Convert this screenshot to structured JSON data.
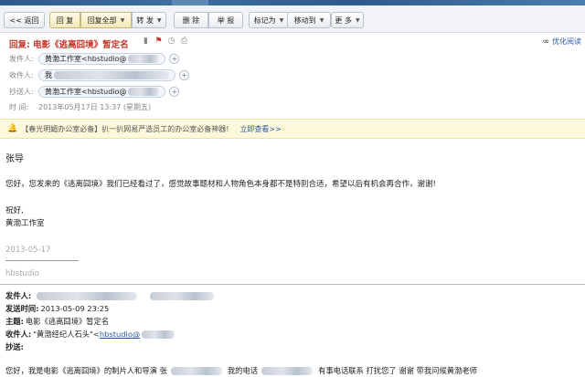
{
  "toolbar": {
    "back": "<< 返回",
    "reply": "回 复",
    "reply_all": "回复全部",
    "forward": "转 发",
    "delete": "删 除",
    "report": "举 报",
    "mark_as": "标记为",
    "move_to": "移动到",
    "more": "更 多"
  },
  "header": {
    "subject": "回复: 电影《逃离囧境》暂定名",
    "optimized_read": "优化阅读",
    "sender_label": "发件人:",
    "sender": "黄渤工作室<hbstudio@",
    "recipient_label": "收件人:",
    "recipient": "我",
    "cc_label": "抄送人:",
    "cc": "黄渤工作室<hbstudio@",
    "time_label": "时 间:",
    "time": "2013年05月17日 13:37 (星期五)"
  },
  "promo": {
    "text": "【春光明媚办公室必备】扒一扒网易严选员工的办公室必备神器!",
    "link": "立即查看>>"
  },
  "body": {
    "greeting": "张导",
    "paragraph": "您好，您发来的《逃离囧境》我们已经看过了，感觉故事题材和人物角色本身都不是特别合适，希望以后有机会再合作，谢谢!",
    "closing": "祝好,",
    "signature": "黄渤工作室",
    "date": "2013-05-17",
    "sig_name": "hbstudio",
    "fwd_from_label": "发件人:",
    "fwd_sent_label": "发送时间:",
    "fwd_sent": "2013-05-09 23:25",
    "fwd_subject_label": "主题:",
    "fwd_subject": "电影《逃离囧境》暂定名",
    "fwd_to_label": "收件人:",
    "fwd_to": "\"黄渤经纪人石头\"<",
    "fwd_to_link": "hbstudio@",
    "fwd_cc_label": "抄送:",
    "orig_a": "您好，我是电影《逃离囧境》的制片人和导演  张",
    "orig_b": "我的电话",
    "orig_c": "有事电话联系  打扰您了 谢谢  带我问候黄渤老师"
  },
  "colors": {
    "subject": "#c8362b",
    "link": "#2a5aa0",
    "promo_bg": "#fdf7dc"
  }
}
